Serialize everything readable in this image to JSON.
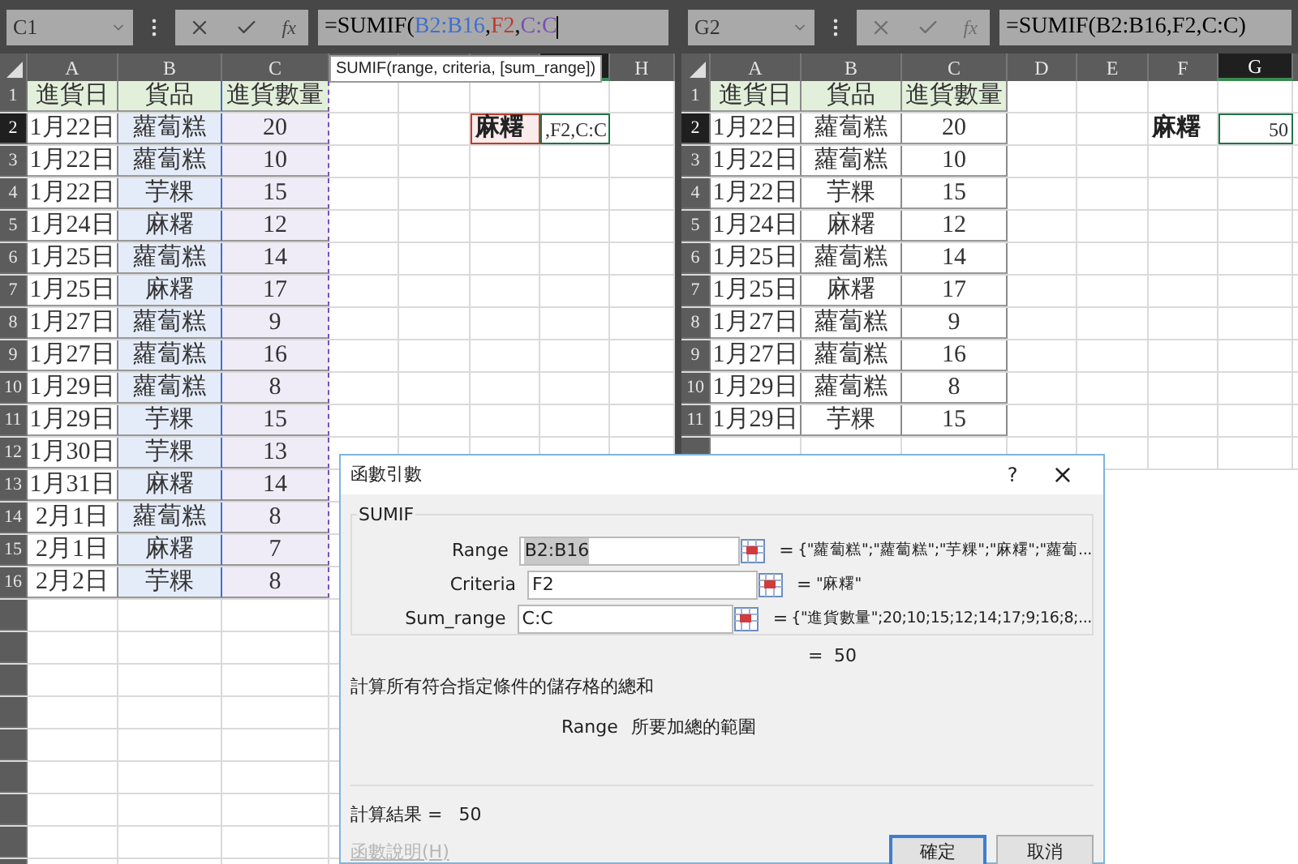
{
  "left_pane": {
    "name_box": "C1",
    "buttons_enabled": true,
    "function_button": "fx",
    "formula_parts": [
      {
        "text": "=SUMIF(",
        "color": "#000000"
      },
      {
        "text": "B2:B16",
        "color": "#3f6fd1"
      },
      {
        "text": ",",
        "color": "#000000"
      },
      {
        "text": "F2",
        "color": "#c0392b"
      },
      {
        "text": ",",
        "color": "#000000"
      },
      {
        "text": "C:C",
        "color": "#7a4fb5"
      }
    ],
    "tooltip": "SUMIF(range, criteria, [sum_range])",
    "columns": [
      {
        "label": "A",
        "selected": false
      },
      {
        "label": "B",
        "selected": false
      },
      {
        "label": "C",
        "selected": false
      },
      {
        "selected": false
      },
      {
        "selected": false
      },
      {
        "selected": false
      },
      {
        "selected": true
      },
      {
        "label": "H",
        "selected": false
      }
    ],
    "rows": [
      {
        "label": "1",
        "selected": false,
        "cells": [
          "進貨日",
          "貨品",
          "進貨數量"
        ]
      },
      {
        "label": "2",
        "selected": true,
        "cells": [
          "1月22日",
          "蘿蔔糕",
          "20"
        ]
      },
      {
        "label": "3",
        "selected": false,
        "cells": [
          "1月22日",
          "蘿蔔糕",
          "10"
        ]
      },
      {
        "label": "4",
        "selected": false,
        "cells": [
          "1月22日",
          "芋粿",
          "15"
        ]
      },
      {
        "label": "5",
        "selected": false,
        "cells": [
          "1月24日",
          "麻糬",
          "12"
        ]
      },
      {
        "label": "6",
        "selected": false,
        "cells": [
          "1月25日",
          "蘿蔔糕",
          "14"
        ]
      },
      {
        "label": "7",
        "selected": false,
        "cells": [
          "1月25日",
          "麻糬",
          "17"
        ]
      },
      {
        "label": "8",
        "selected": false,
        "cells": [
          "1月27日",
          "蘿蔔糕",
          "9"
        ]
      },
      {
        "label": "9",
        "selected": false,
        "cells": [
          "1月27日",
          "蘿蔔糕",
          "16"
        ]
      },
      {
        "label": "10",
        "selected": false,
        "cells": [
          "1月29日",
          "蘿蔔糕",
          "8"
        ]
      },
      {
        "label": "11",
        "selected": false,
        "cells": [
          "1月29日",
          "芋粿",
          "15"
        ]
      },
      {
        "label": "12",
        "selected": false,
        "cells": [
          "1月30日",
          "芋粿",
          "13"
        ]
      },
      {
        "label": "13",
        "selected": false,
        "cells": [
          "1月31日",
          "麻糬",
          "14"
        ]
      },
      {
        "label": "14",
        "selected": false,
        "cells": [
          "2月1日",
          "蘿蔔糕",
          "8"
        ]
      },
      {
        "label": "15",
        "selected": false,
        "cells": [
          "2月1日",
          "麻糬",
          "7"
        ]
      },
      {
        "label": "16",
        "selected": false,
        "cells": [
          "2月2日",
          "芋粿",
          "8"
        ]
      }
    ],
    "criteria_cell": "麻糬",
    "result_cell": ",F2,C:C"
  },
  "right_pane": {
    "name_box": "G2",
    "buttons_enabled": false,
    "function_button": "fx",
    "formula_parts": [
      {
        "text": "=SUMIF(B2:B16,F2,C:C)",
        "color": "#000000"
      }
    ],
    "columns": [
      {
        "label": "A",
        "selected": false
      },
      {
        "label": "B",
        "selected": false
      },
      {
        "label": "C",
        "selected": false
      },
      {
        "label": "D",
        "selected": false
      },
      {
        "label": "E",
        "selected": false
      },
      {
        "label": "F",
        "selected": false
      },
      {
        "label": "G",
        "selected": true
      }
    ],
    "rows": [
      {
        "label": "1",
        "selected": false,
        "cells": [
          "進貨日",
          "貨品",
          "進貨數量"
        ]
      },
      {
        "label": "2",
        "selected": true,
        "cells": [
          "1月22日",
          "蘿蔔糕",
          "20"
        ]
      },
      {
        "label": "3",
        "selected": false,
        "cells": [
          "1月22日",
          "蘿蔔糕",
          "10"
        ]
      },
      {
        "label": "4",
        "selected": false,
        "cells": [
          "1月22日",
          "芋粿",
          "15"
        ]
      },
      {
        "label": "5",
        "selected": false,
        "cells": [
          "1月24日",
          "麻糬",
          "12"
        ]
      },
      {
        "label": "6",
        "selected": false,
        "cells": [
          "1月25日",
          "蘿蔔糕",
          "14"
        ]
      },
      {
        "label": "7",
        "selected": false,
        "cells": [
          "1月25日",
          "麻糬",
          "17"
        ]
      },
      {
        "label": "8",
        "selected": false,
        "cells": [
          "1月27日",
          "蘿蔔糕",
          "9"
        ]
      },
      {
        "label": "9",
        "selected": false,
        "cells": [
          "1月27日",
          "蘿蔔糕",
          "16"
        ]
      },
      {
        "label": "10",
        "selected": false,
        "cells": [
          "1月29日",
          "蘿蔔糕",
          "8"
        ]
      },
      {
        "label": "11",
        "selected": false,
        "cells": [
          "1月29日",
          "芋粿",
          "15"
        ]
      }
    ],
    "criteria_cell": "麻糬",
    "result_cell": "50"
  },
  "dialog": {
    "title": "函數引數",
    "help": "?",
    "close": "×",
    "function_name": "SUMIF",
    "arguments": [
      {
        "label": "Range",
        "value": "B2:B16",
        "result": "{\"蘿蔔糕\";\"蘿蔔糕\";\"芋粿\";\"麻糬\";\"蘿蔔...",
        "selected": true
      },
      {
        "label": "Criteria",
        "value": "F2",
        "result": "\"麻糬\"",
        "selected": false
      },
      {
        "label": "Sum_range",
        "value": "C:C",
        "result": "{\"進貨數量\";20;10;15;12;14;17;9;16;8;...",
        "selected": false
      }
    ],
    "equals": "=",
    "formula_result": "50",
    "description": "計算所有符合指定條件的儲存格的總和",
    "argument_name": "Range",
    "argument_help": "所要加總的範圍",
    "result_label": "計算結果 =",
    "result_value": "50",
    "help_link": "函數說明(H)",
    "ok_button": "確定",
    "cancel_button": "取消"
  }
}
